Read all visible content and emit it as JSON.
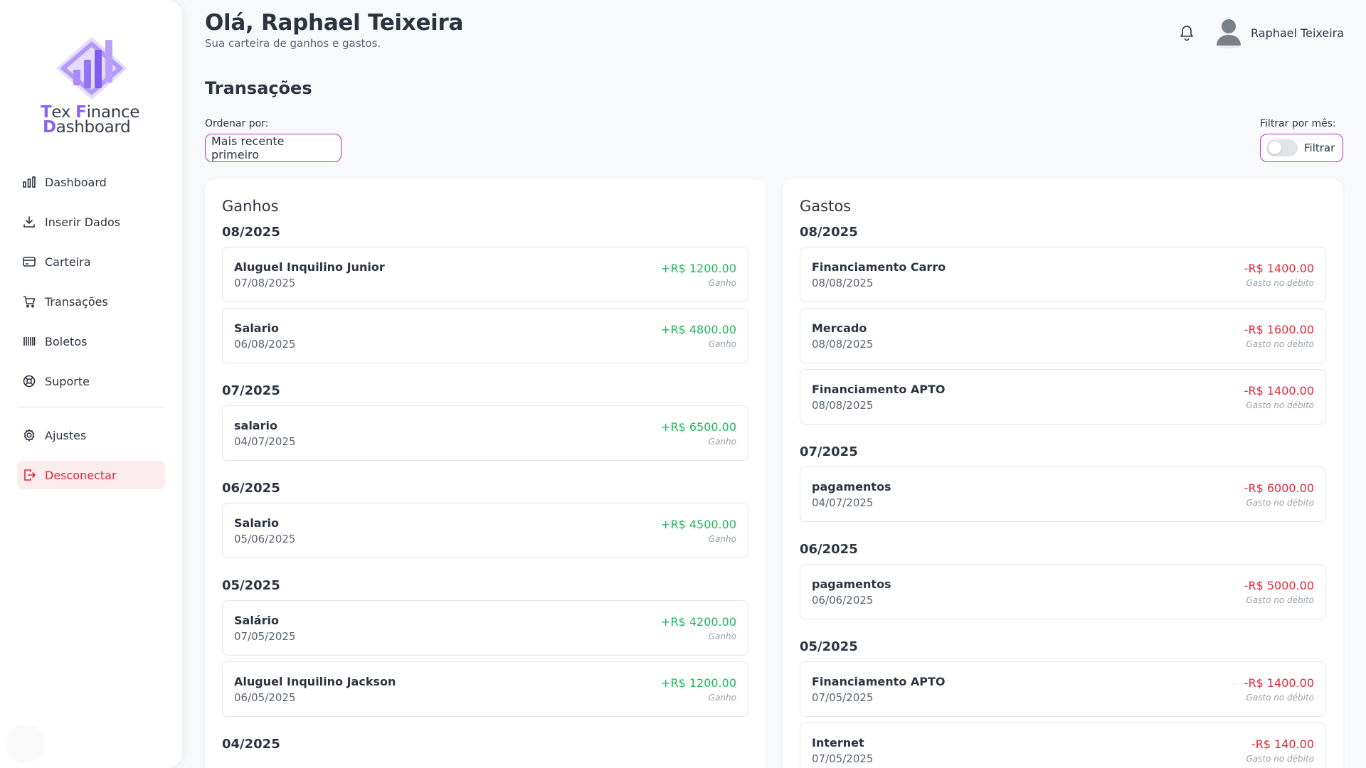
{
  "brand": {
    "line1_a": "T",
    "line1_b": "ex ",
    "line1_c": "F",
    "line1_d": "inance",
    "line2_a": "D",
    "line2_b": "ashboard"
  },
  "nav": {
    "dashboard": "Dashboard",
    "inserir": "Inserir Dados",
    "carteira": "Carteira",
    "transacoes": "Transações",
    "boletos": "Boletos",
    "suporte": "Suporte",
    "ajustes": "Ajustes",
    "desconectar": "Desconectar"
  },
  "header": {
    "greeting": "Olá, Raphael Teixeira",
    "subtitle": "Sua carteira de ganhos e gastos.",
    "user_name": "Raphael Teixeira"
  },
  "page": {
    "title": "Transações",
    "order_label": "Ordenar por:",
    "order_value": "Mais recente primeiro",
    "filter_label": "Filtrar por mês:",
    "filter_button": "Filtrar",
    "filter_enabled": false
  },
  "colors": {
    "accent": "#8b63f0",
    "border_accent": "#c02fc4",
    "gain": "#1fb85a",
    "expense": "#e0293b",
    "logout": "#d6283a"
  },
  "ganhos": {
    "title": "Ganhos",
    "groups": [
      {
        "month": "08/2025",
        "items": [
          {
            "name": "Aluguel Inquilino Junior",
            "date": "07/08/2025",
            "value": "+R$ 1200.00",
            "type": "Ganho"
          },
          {
            "name": "Salario",
            "date": "06/08/2025",
            "value": "+R$ 4800.00",
            "type": "Ganho"
          }
        ]
      },
      {
        "month": "07/2025",
        "items": [
          {
            "name": "salario",
            "date": "04/07/2025",
            "value": "+R$ 6500.00",
            "type": "Ganho"
          }
        ]
      },
      {
        "month": "06/2025",
        "items": [
          {
            "name": "Salario",
            "date": "05/06/2025",
            "value": "+R$ 4500.00",
            "type": "Ganho"
          }
        ]
      },
      {
        "month": "05/2025",
        "items": [
          {
            "name": "Salário",
            "date": "07/05/2025",
            "value": "+R$ 4200.00",
            "type": "Ganho"
          },
          {
            "name": "Aluguel Inquilino Jackson",
            "date": "06/05/2025",
            "value": "+R$ 1200.00",
            "type": "Ganho"
          }
        ]
      },
      {
        "month": "04/2025",
        "items": []
      }
    ]
  },
  "gastos": {
    "title": "Gastos",
    "groups": [
      {
        "month": "08/2025",
        "items": [
          {
            "name": "Financiamento Carro",
            "date": "08/08/2025",
            "value": "-R$ 1400.00",
            "type": "Gasto no débito"
          },
          {
            "name": "Mercado",
            "date": "08/08/2025",
            "value": "-R$ 1600.00",
            "type": "Gasto no débito"
          },
          {
            "name": "Financiamento APTO",
            "date": "08/08/2025",
            "value": "-R$ 1400.00",
            "type": "Gasto no débito"
          }
        ]
      },
      {
        "month": "07/2025",
        "items": [
          {
            "name": "pagamentos",
            "date": "04/07/2025",
            "value": "-R$ 6000.00",
            "type": "Gasto no débito"
          }
        ]
      },
      {
        "month": "06/2025",
        "items": [
          {
            "name": "pagamentos",
            "date": "06/06/2025",
            "value": "-R$ 5000.00",
            "type": "Gasto no débito"
          }
        ]
      },
      {
        "month": "05/2025",
        "items": [
          {
            "name": "Financiamento APTO",
            "date": "07/05/2025",
            "value": "-R$ 1400.00",
            "type": "Gasto no débito"
          },
          {
            "name": "Internet",
            "date": "07/05/2025",
            "value": "-R$ 140.00",
            "type": "Gasto no débito"
          }
        ]
      }
    ]
  }
}
